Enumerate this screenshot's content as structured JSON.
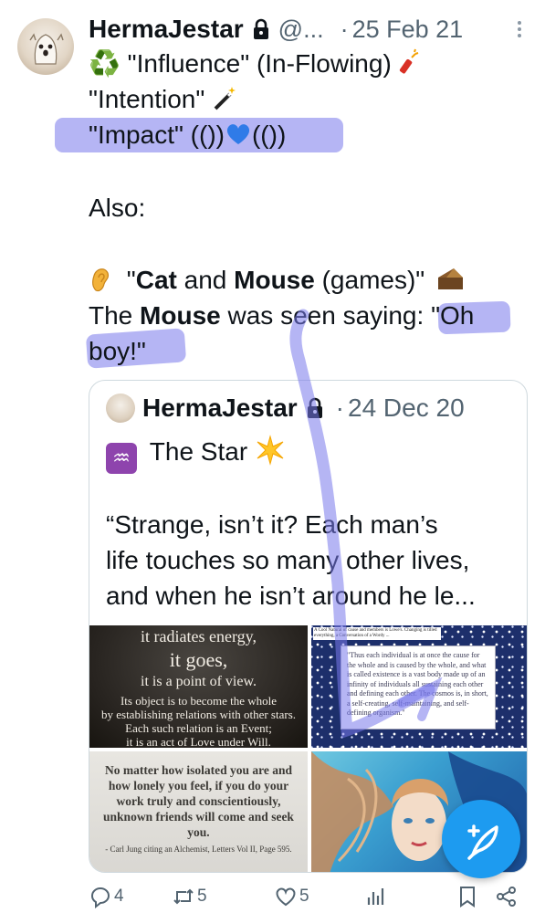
{
  "author": {
    "name": "HermaJestar",
    "handle": "@...",
    "separator": "·",
    "date": "25 Feb 21"
  },
  "tweet": {
    "line1": "\"Influence\" (In-Flowing)",
    "line2": "\"Intention\"",
    "line3_prefix": "\"Impact\" (())",
    "line3_suffix": "(())",
    "line4": "Also:",
    "line5_a": "\"",
    "line5_cat": "Cat",
    "line5_and": " and ",
    "line5_mouse": "Mouse",
    "line5_end": " (games)\"",
    "line6_a": "The ",
    "line6_mouse": "Mouse",
    "line6_b": " was seen saying: \"Oh",
    "line7": "boy!\""
  },
  "quoted": {
    "name": "HermaJestar",
    "separator": "·",
    "date": "24 Dec 20",
    "title": "The Star",
    "aquarius": "♒",
    "text1": "“Strange, isn’t it? Each man’s",
    "text2": "life touches so many other lives,",
    "text3": "and when he isn’t around he le..."
  },
  "images": {
    "img1_a": "it radiates energy,",
    "img1_b": "it goes,",
    "img1_c": "it is a point of view.",
    "img1_d1": "Its object is to become the whole",
    "img1_d2": "by establishing relations with other stars.",
    "img1_d3": "Each such relation is an Event;",
    "img1_d4": "it is an act of Love under Will.",
    "img2_cap": "A Cool Natural of cause and members is Lowe's. Changing is tilled everything, a Conversation of a Wordy ...",
    "img2_card": "\"Thus each individual is at once the cause for the whole and is caused by the whole, and what is called existence is a vast body made up of an infinity of individuals all sustaining each other and defining each other. The cosmos is, in short, a self-creating, self-maintaining, and self-defining organism.\"",
    "img3_t1": "No matter how isolated you are and",
    "img3_t2": "how lonely you feel, if you do your",
    "img3_t3": "work truly and conscientiously,",
    "img3_t4": "unknown friends will come and seek",
    "img3_t5": "you.",
    "img3_s": "- Carl Jung citing an Alchemist, Letters Vol II, Page 595."
  },
  "actions": {
    "replies": "4",
    "retweets": "5",
    "likes": "5"
  },
  "colors": {
    "highlight": "#7878eb",
    "accent": "#1d9bf0",
    "muted": "#536471"
  }
}
